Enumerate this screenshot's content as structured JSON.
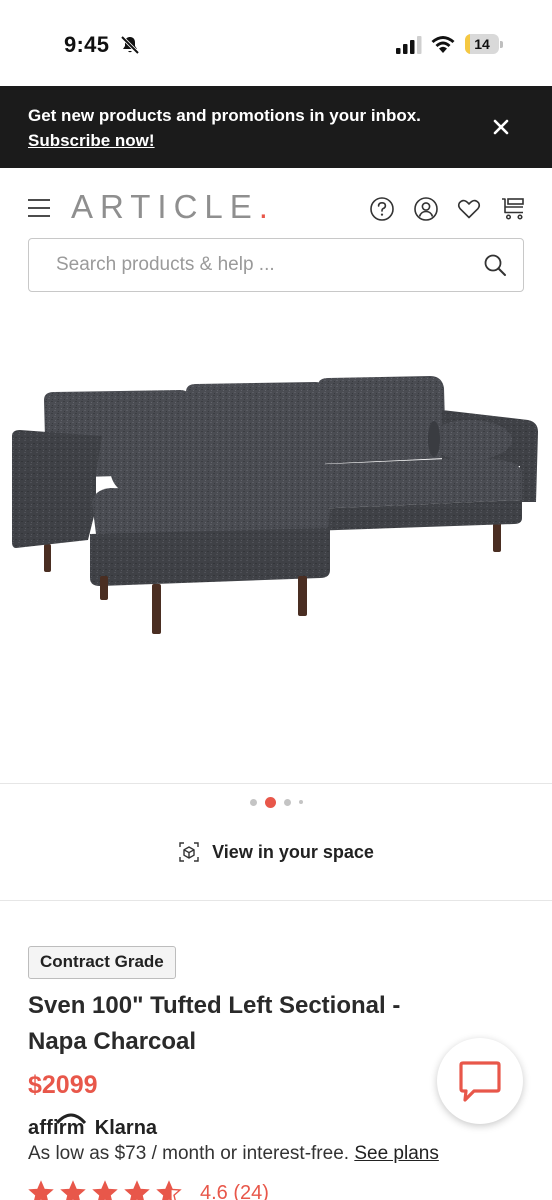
{
  "status_bar": {
    "time": "9:45",
    "battery": "14",
    "battery_level": 0.14
  },
  "promo": {
    "text": "Get new products and promotions in your inbox.",
    "link": "Subscribe now!",
    "close_icon": "close-icon"
  },
  "header": {
    "logo": "ARTICLE",
    "logo_dot": ".",
    "icons": [
      "menu-icon",
      "help-icon",
      "account-icon",
      "heart-icon",
      "cart-icon"
    ]
  },
  "search": {
    "placeholder": "Search products & help ..."
  },
  "gallery": {
    "image": "charcoal-left-sectional-sofa",
    "dots": 4,
    "active_dot": 2
  },
  "view_in_space": {
    "label": "View in your space",
    "icon": "ar-cube-icon"
  },
  "product": {
    "badge": "Contract Grade",
    "title": "Sven 100\" Tufted Left Sectional - Napa Charcoal",
    "price": "$2099",
    "financing_providers": [
      "affirm",
      "Klarna"
    ],
    "financing_text": "As low as $73 / month or interest-free.",
    "see_plans": "See plans",
    "rating_value": 4.6,
    "rating_text": "4.6 (24)"
  },
  "colors": {
    "accent": "#e8574a",
    "banner_bg": "#1b1b1b",
    "logo_gray": "#8f8f8f"
  },
  "chat": {
    "icon": "chat-icon"
  }
}
